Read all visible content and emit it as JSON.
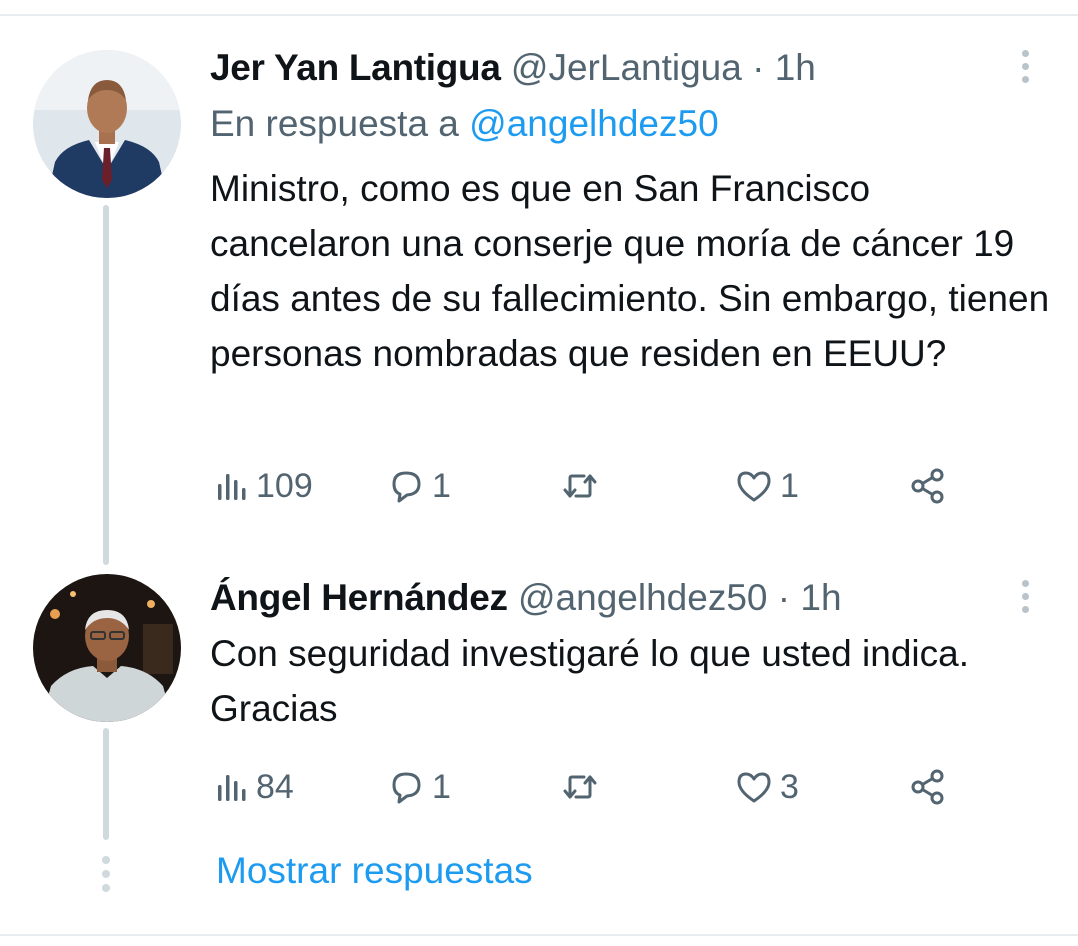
{
  "tweets": [
    {
      "name": "Jer Yan Lantigua",
      "handle": "@JerLantigua",
      "separator": "·",
      "time": "1h",
      "reply_prefix": "En respuesta a",
      "reply_handle": "@angelhdez50",
      "text": "Ministro, como es que en San Francisco cancelaron una conserje que moría de cáncer 19 días antes de su fallecimiento. Sin embargo, tienen personas nombradas que residen en EEUU?",
      "views": "109",
      "replies": "1",
      "retweets": "",
      "likes": "1",
      "avatar_icon": "man-in-suit-avatar"
    },
    {
      "name": "Ángel Hernández",
      "handle": "@angelhdez50",
      "separator": "·",
      "time": "1h",
      "text": "Con seguridad investigaré lo que usted indica. Gracias",
      "views": "84",
      "replies": "1",
      "retweets": "",
      "likes": "3",
      "avatar_icon": "older-man-avatar"
    }
  ],
  "show_replies_label": "Mostrar respuestas",
  "colors": {
    "link": "#1d9bf0",
    "secondary_text": "#536471",
    "primary_text": "#0f1419",
    "thread_line": "#cfd9de"
  },
  "icons": [
    "views-icon",
    "reply-icon",
    "retweet-icon",
    "like-icon",
    "share-icon",
    "more-icon"
  ]
}
